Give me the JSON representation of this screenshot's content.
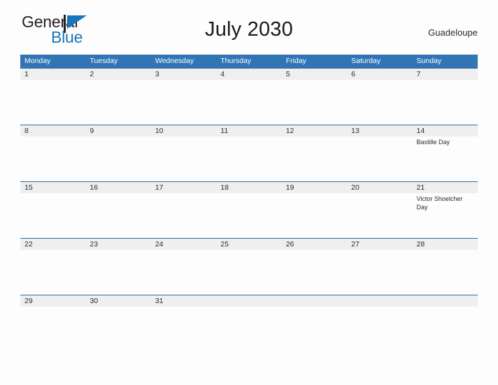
{
  "brand": {
    "name_part1": "General",
    "name_part2": "Blue",
    "flag_color": "#1b75bb",
    "text_color": "#231f20"
  },
  "header": {
    "title": "July 2030",
    "location": "Guadeloupe"
  },
  "theme": {
    "header_blue": "#3175b5",
    "divider_blue": "#2e6da4",
    "number_band": "#efefef",
    "page_background": "#fdfdfd"
  },
  "calendar": {
    "weekdays": [
      "Monday",
      "Tuesday",
      "Wednesday",
      "Thursday",
      "Friday",
      "Saturday",
      "Sunday"
    ],
    "weeks": [
      {
        "days": [
          {
            "number": "1",
            "events": []
          },
          {
            "number": "2",
            "events": []
          },
          {
            "number": "3",
            "events": []
          },
          {
            "number": "4",
            "events": []
          },
          {
            "number": "5",
            "events": []
          },
          {
            "number": "6",
            "events": []
          },
          {
            "number": "7",
            "events": []
          }
        ]
      },
      {
        "days": [
          {
            "number": "8",
            "events": []
          },
          {
            "number": "9",
            "events": []
          },
          {
            "number": "10",
            "events": []
          },
          {
            "number": "11",
            "events": []
          },
          {
            "number": "12",
            "events": []
          },
          {
            "number": "13",
            "events": []
          },
          {
            "number": "14",
            "events": [
              "Bastille Day"
            ]
          }
        ]
      },
      {
        "days": [
          {
            "number": "15",
            "events": []
          },
          {
            "number": "16",
            "events": []
          },
          {
            "number": "17",
            "events": []
          },
          {
            "number": "18",
            "events": []
          },
          {
            "number": "19",
            "events": []
          },
          {
            "number": "20",
            "events": []
          },
          {
            "number": "21",
            "events": [
              "Victor Shoelcher Day"
            ]
          }
        ]
      },
      {
        "days": [
          {
            "number": "22",
            "events": []
          },
          {
            "number": "23",
            "events": []
          },
          {
            "number": "24",
            "events": []
          },
          {
            "number": "25",
            "events": []
          },
          {
            "number": "26",
            "events": []
          },
          {
            "number": "27",
            "events": []
          },
          {
            "number": "28",
            "events": []
          }
        ]
      },
      {
        "last": true,
        "days": [
          {
            "number": "29",
            "events": []
          },
          {
            "number": "30",
            "events": []
          },
          {
            "number": "31",
            "events": []
          },
          {
            "number": "",
            "events": []
          },
          {
            "number": "",
            "events": []
          },
          {
            "number": "",
            "events": []
          },
          {
            "number": "",
            "events": []
          }
        ]
      }
    ]
  }
}
